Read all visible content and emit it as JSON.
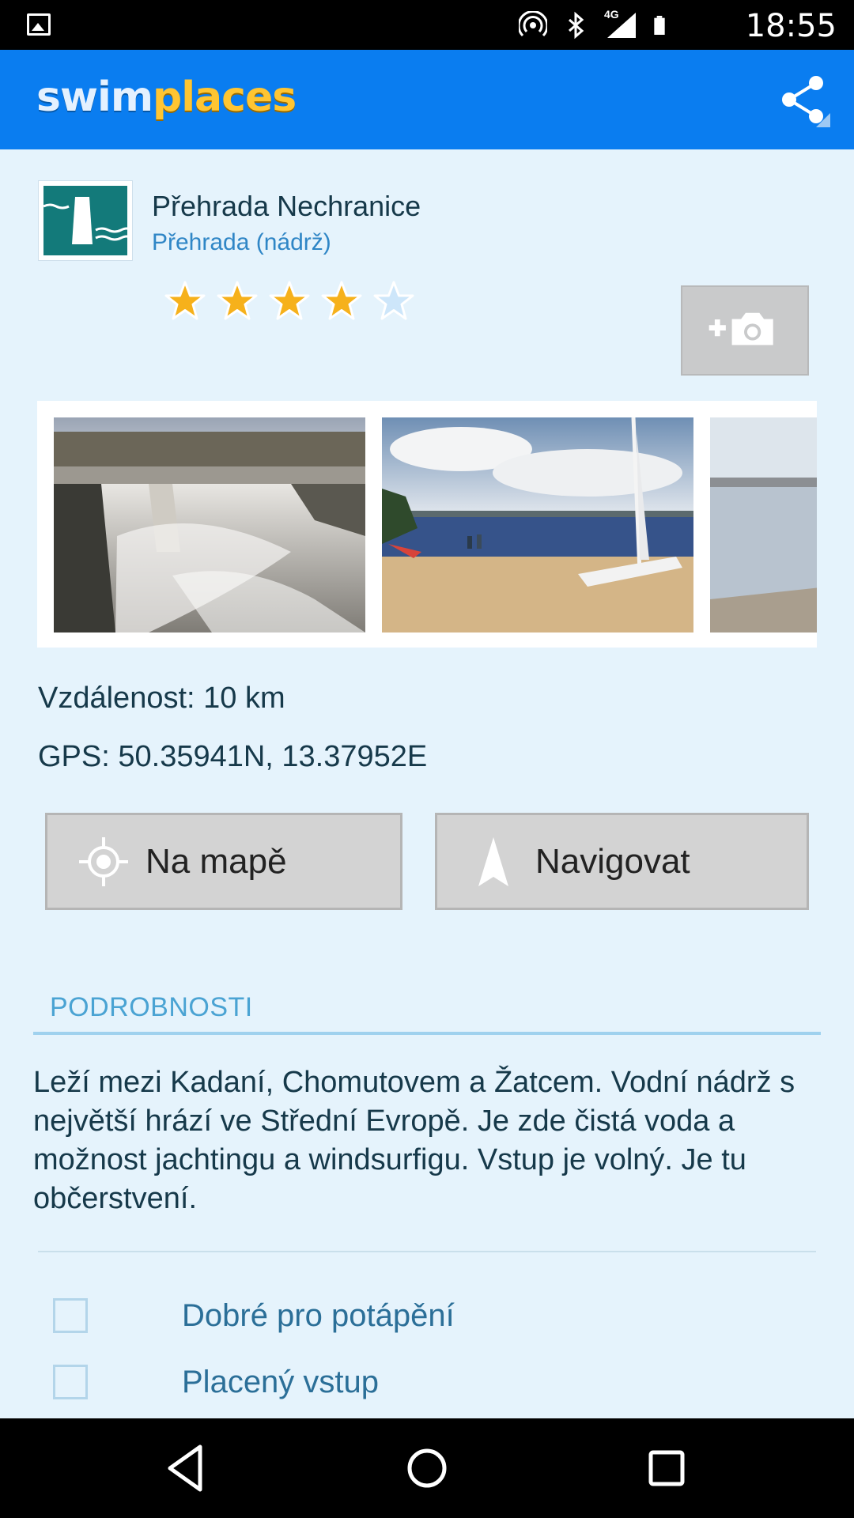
{
  "status_bar": {
    "time": "18:55",
    "network": "4G",
    "icons": [
      "image-notification-icon",
      "hotspot-icon",
      "bluetooth-icon",
      "signal-icon",
      "battery-icon"
    ]
  },
  "app_bar": {
    "logo_swim": "swim",
    "logo_places": "places",
    "share_icon": "share-icon",
    "colors": {
      "background": "#0a7df0",
      "logo_accent": "#ffc532"
    }
  },
  "place": {
    "title": "Přehrada Nechranice",
    "type": "Přehrada (nádrž)",
    "rating": 4,
    "rating_max": 5,
    "icon": "dam-icon",
    "add_photo_icon": "add-camera-icon"
  },
  "gallery": {
    "photos": [
      {
        "name": "photo-dam-spillway"
      },
      {
        "name": "photo-beach-catamaran"
      },
      {
        "name": "photo-lake-shore"
      }
    ]
  },
  "info": {
    "distance": "Vzdálenost: 10 km",
    "gps": "GPS: 50.35941N, 13.37952E"
  },
  "buttons": {
    "map_label": "Na mapě",
    "navigate_label": "Navigovat"
  },
  "details": {
    "section_title": "PODROBNOSTI",
    "description": "Leží mezi Kadaní, Chomutovem a Žatcem. Vodní nádrž s největší hrází ve Střední Evropě. Je zde čistá voda a možnost jachtingu a windsurfigu. Vstup je volný. Je tu občerstvení.",
    "checkboxes": [
      {
        "label": "Dobré pro potápění",
        "checked": false
      },
      {
        "label": "Placený vstup",
        "checked": false
      }
    ]
  },
  "nav_bar": {
    "buttons": [
      "back-icon",
      "home-icon",
      "recents-icon"
    ]
  }
}
